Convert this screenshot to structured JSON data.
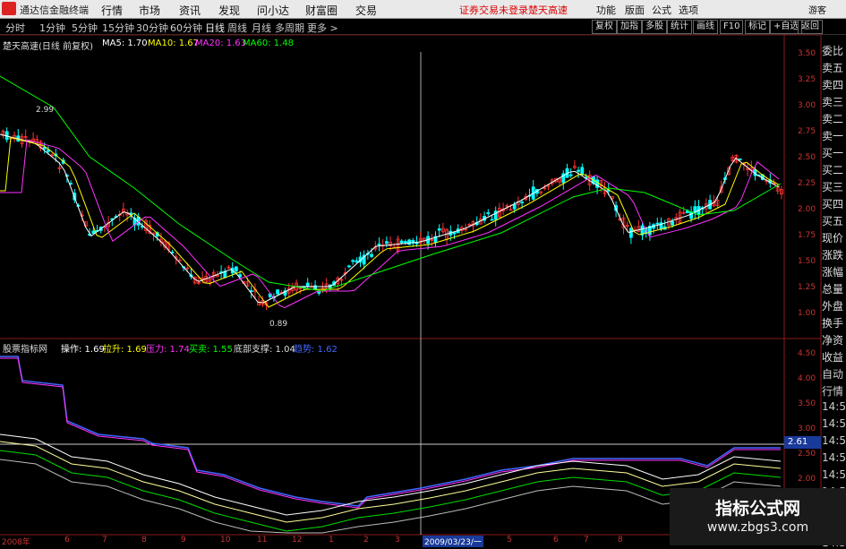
{
  "menubar": {
    "app_title": "通达信金融终端",
    "items": [
      "行情",
      "市场",
      "资讯",
      "发现",
      "问小达",
      "财富圈",
      "交易"
    ],
    "warn1": "证券交易未登录",
    "warn2": "楚天高速",
    "right_items": [
      "功能",
      "版面",
      "公式",
      "选项"
    ],
    "user": "游客"
  },
  "toolbar": {
    "periods": [
      "分时",
      "1分钟",
      "5分钟",
      "15分钟",
      "30分钟",
      "60分钟",
      "日线",
      "周线",
      "月线",
      "多周期",
      "更多 >"
    ],
    "active_period": "日线",
    "right_buttons": [
      "复权",
      "加指",
      "多股",
      "统计",
      "画线",
      "F10",
      "标记",
      "+自选",
      "返回"
    ]
  },
  "main_chart": {
    "stock": "楚天高速(日线 前复权)",
    "ma5": "MA5: 1.70",
    "ma10": "MA10: 1.67",
    "ma20": "MA20: 1.63",
    "ma60": "MA60: 1.48",
    "y_ticks": [
      "3.50",
      "3.25",
      "3.00",
      "2.75",
      "2.50",
      "2.25",
      "2.00",
      "1.75",
      "1.50",
      "1.25",
      "1.00"
    ],
    "high_label": "2.99",
    "low_label": "0.89"
  },
  "indicator": {
    "name": "股票指标网",
    "op": "操作: 1.69",
    "la": "拉升: 1.69",
    "ya": "压力: 1.74",
    "mm": "买卖: 1.55",
    "db": "底部支撑: 1.04",
    "dd": "趋势: 1.62",
    "y_ticks": [
      "4.50",
      "4.00",
      "3.50",
      "3.00",
      "2.50",
      "2.00"
    ],
    "cursor_value": "2.61"
  },
  "x_axis": {
    "labels": [
      "2008年",
      "6",
      "7",
      "8",
      "9",
      "10",
      "11",
      "12",
      "1",
      "2",
      "3",
      "2009/03/23/一",
      "5",
      "6",
      "7",
      "8"
    ]
  },
  "right_panel": {
    "labels": [
      "委比",
      "卖五",
      "卖四",
      "卖三",
      "卖二",
      "卖一",
      "买一",
      "买二",
      "买三",
      "买四",
      "买五",
      "现价",
      "涨跌",
      "涨幅",
      "总量",
      "外盘",
      "换手",
      "净资",
      "收益",
      "自动",
      "行情",
      "14:5",
      "14:5",
      "14:5",
      "14:5",
      "14:5",
      "14:5",
      "14:5",
      "14:5",
      "14:5"
    ]
  },
  "watermark": {
    "title": "指标公式网",
    "url": "www.zbgs3.com"
  },
  "colors": {
    "ma5": "#ffffff",
    "ma10": "#ffff00",
    "ma20": "#ff33ff",
    "ma60": "#00ff00",
    "up": "#ff3333",
    "down": "#00ffff"
  }
}
